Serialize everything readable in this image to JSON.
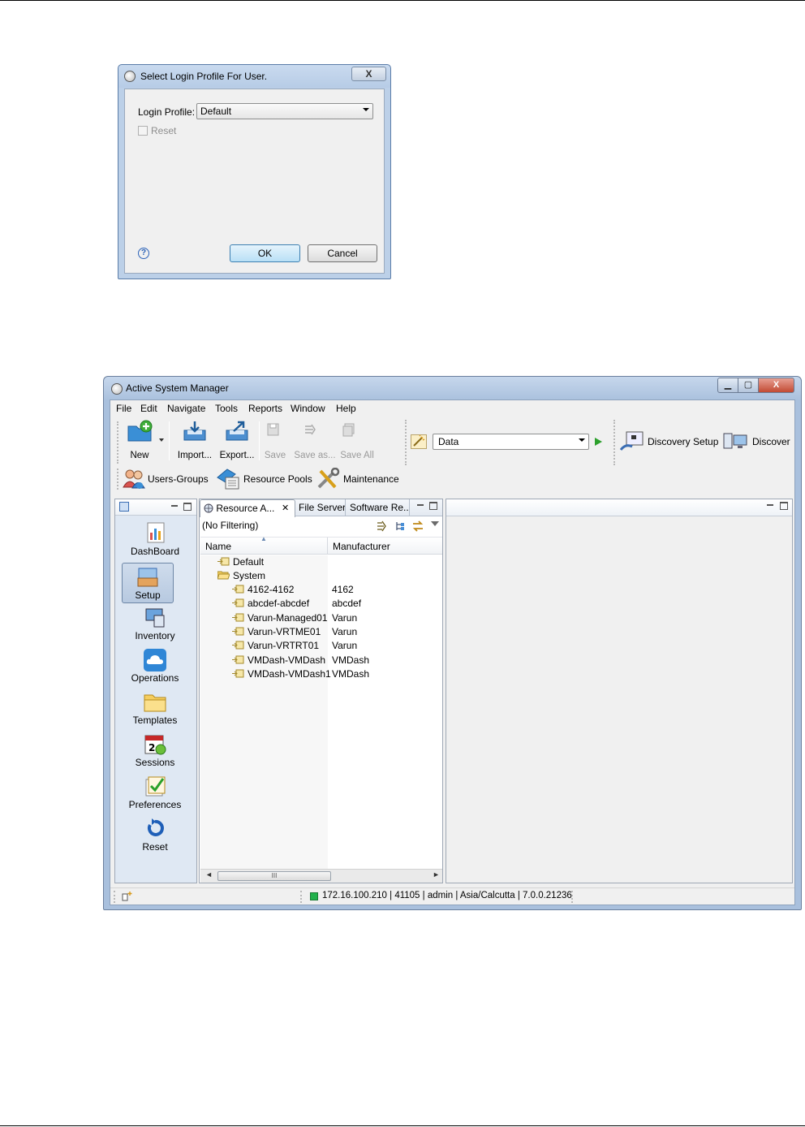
{
  "dialog": {
    "title": "Select Login Profile For User.",
    "close_glyph": "X",
    "login_profile_label": "Login Profile:",
    "login_profile_value": "Default",
    "reset_label": "Reset",
    "help_glyph": "?",
    "ok_label": "OK",
    "cancel_label": "Cancel"
  },
  "window": {
    "title": "Active System Manager",
    "caption_buttons": {
      "minimize": "▁",
      "maximize": "▢",
      "close": "X"
    },
    "menu": [
      "File",
      "Edit",
      "Navigate",
      "Tools",
      "Reports",
      "Window",
      "Help"
    ],
    "toolbar": {
      "new": "New",
      "import": "Import...",
      "export": "Export...",
      "save": "Save",
      "save_as": "Save as...",
      "save_all": "Save All",
      "data_combo": "Data",
      "discovery_setup": "Discovery Setup",
      "discover": "Discover",
      "users_groups": "Users-Groups",
      "resource_pools": "Resource Pools",
      "maintenance": "Maintenance"
    },
    "nav": [
      "DashBoard",
      "Setup",
      "Inventory",
      "Operations",
      "Templates",
      "Sessions",
      "Preferences",
      "Reset"
    ],
    "tabs": {
      "resource": "Resource A...",
      "resource_close": "✕",
      "file_servers": "File Servers",
      "software": "Software Re..."
    },
    "filter": "(No Filtering)",
    "columns": {
      "name": "Name",
      "manufacturer": "Manufacturer"
    },
    "tree": {
      "default": "Default",
      "system": "System",
      "rows": [
        {
          "name": "4162-4162",
          "manufacturer": "4162"
        },
        {
          "name": "abcdef-abcdef",
          "manufacturer": "abcdef"
        },
        {
          "name": "Varun-Managed01",
          "manufacturer": "Varun"
        },
        {
          "name": "Varun-VRTME01",
          "manufacturer": "Varun"
        },
        {
          "name": "Varun-VRTRT01",
          "manufacturer": "Varun"
        },
        {
          "name": "VMDash-VMDash",
          "manufacturer": "VMDash"
        },
        {
          "name": "VMDash-VMDash1",
          "manufacturer": "VMDash"
        }
      ]
    },
    "scroll_thumb": "III",
    "status": "172.16.100.210 | 41105 | admin | Asia/Calcutta | 7.0.0.21236",
    "colors": {
      "status_ok": "#22b14c",
      "title_bar": "#b7cce6",
      "tree_col_bg": "#ffffff"
    }
  }
}
